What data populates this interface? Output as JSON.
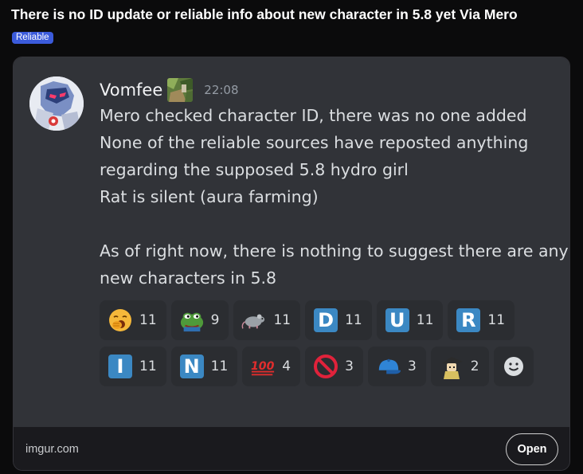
{
  "post": {
    "title": "There is no ID update or reliable info about new character in 5.8 yet Via Mero",
    "flair": "Reliable"
  },
  "message": {
    "username": "Vomfee",
    "timestamp": "22:08",
    "lines": [
      "Mero checked character ID, there was no one added",
      "None of the reliable sources have reposted anything",
      "regarding the supposed 5.8 hydro girl",
      "Rat is silent (aura farming)",
      "",
      "As of right now, there is nothing to suggest there are any",
      "new characters in 5.8"
    ]
  },
  "reactions": {
    "row1": [
      {
        "icon": "yawning-face-icon",
        "count": "11"
      },
      {
        "icon": "pepe-frog-icon",
        "count": "9"
      },
      {
        "icon": "rat-icon",
        "count": "11"
      },
      {
        "icon": "letter-d-icon",
        "letter": "D",
        "count": "11"
      },
      {
        "icon": "letter-u-icon",
        "letter": "U",
        "count": "11"
      },
      {
        "icon": "letter-r-icon",
        "letter": "R",
        "count": "11"
      }
    ],
    "row2": [
      {
        "icon": "letter-i-icon",
        "letter": "I",
        "count": "11"
      },
      {
        "icon": "letter-n-icon",
        "letter": "N",
        "count": "11"
      },
      {
        "icon": "hundred-points-icon",
        "glyph": "100",
        "count": "4"
      },
      {
        "icon": "prohibited-icon",
        "count": "3"
      },
      {
        "icon": "blue-cap-icon",
        "count": "3"
      },
      {
        "icon": "character-sticker-icon",
        "count": "2"
      }
    ]
  },
  "footer": {
    "source": "imgur.com",
    "open_label": "Open"
  },
  "colors": {
    "flair": "#3b5bdb",
    "discord_bg": "#313338",
    "reaction_bg": "#2b2d31",
    "letter_tile": "#3b88c3"
  }
}
